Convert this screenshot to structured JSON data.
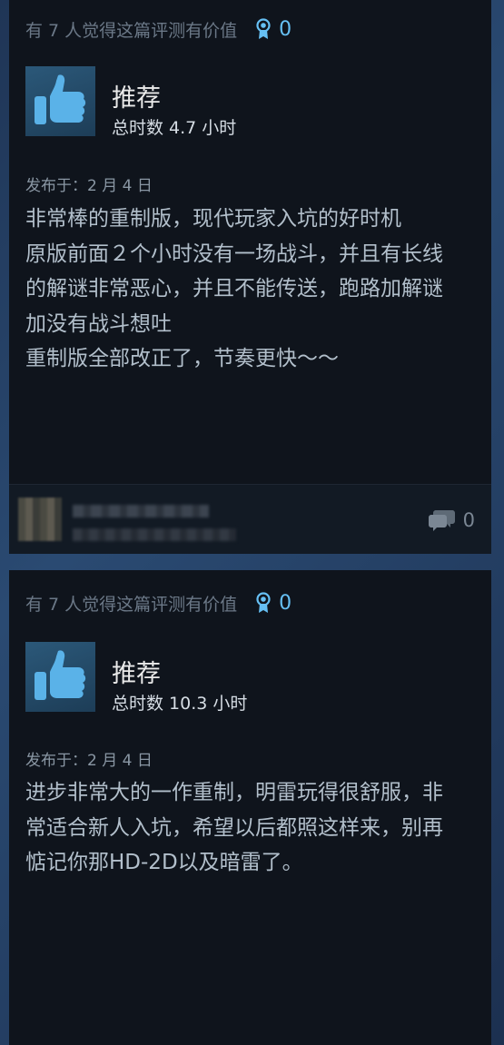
{
  "reviews": [
    {
      "helpful_text": "有 7 人觉得这篇评测有价值",
      "award_count": "0",
      "verdict": "推荐",
      "hours": "总时数 4.7 小时",
      "posted": "发布于：2 月 4 日",
      "lines": [
        "非常棒的重制版，现代玩家入坑的好时机",
        "原版前面２个小时没有一场战斗，并且有长线",
        "的解谜非常恶心，并且不能传送，跑路加解谜",
        "加没有战斗想吐",
        "重制版全部改正了，节奏更快～～"
      ],
      "comment_count": "0"
    },
    {
      "helpful_text": "有 7 人觉得这篇评测有价值",
      "award_count": "0",
      "verdict": "推荐",
      "hours": "总时数 10.3 小时",
      "posted": "发布于：2 月 4 日",
      "lines": [
        "进步非常大的一作重制，明雷玩得很舒服，非",
        "常适合新人入坑，希望以后都照这样来，别再",
        "惦记你那HD-2D以及暗雷了。"
      ]
    }
  ],
  "icons": {
    "award": "award-ribbon-icon",
    "thumb": "thumbs-up-icon",
    "comments": "comment-bubbles-icon"
  },
  "colors": {
    "card_bg": "#0f141c",
    "accent": "#66c0f4",
    "thumb": "#5ab2e8"
  }
}
